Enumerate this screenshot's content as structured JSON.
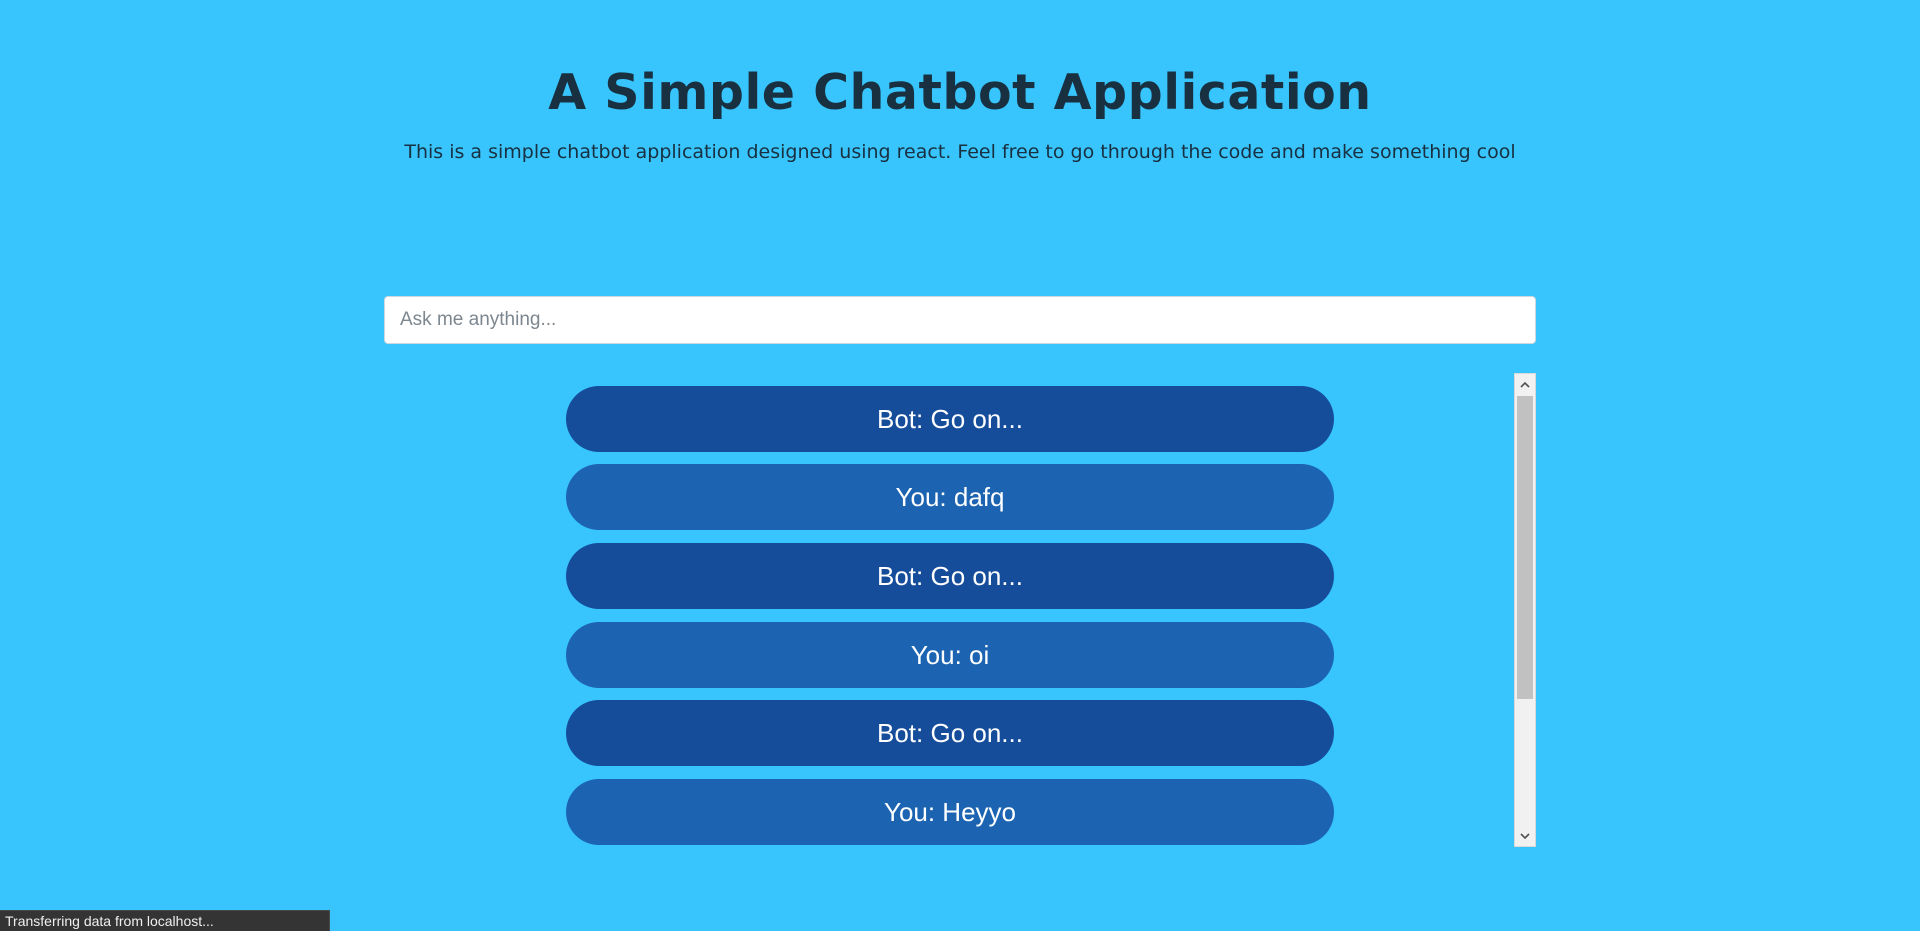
{
  "header": {
    "title": "A Simple Chatbot Application",
    "subtitle": "This is a simple chatbot application designed using react. Feel free to go through the code and make something cool"
  },
  "chat": {
    "input_value": "",
    "input_placeholder": "Ask me anything...",
    "messages": [
      {
        "sender": "bot",
        "text": "Bot: Go on..."
      },
      {
        "sender": "user",
        "text": "You: dafq"
      },
      {
        "sender": "bot",
        "text": "Bot: Go on..."
      },
      {
        "sender": "user",
        "text": "You: oi"
      },
      {
        "sender": "bot",
        "text": "Bot: Go on..."
      },
      {
        "sender": "user",
        "text": "You: Heyyo"
      }
    ]
  },
  "scrollbar": {
    "up_icon": "chevron-up-icon",
    "down_icon": "chevron-down-icon"
  },
  "status_bar": {
    "text": "Transferring data from localhost..."
  },
  "colors": {
    "background": "#38c4fd",
    "bot_bubble": "#154d9b",
    "user_bubble": "#1c64b1",
    "title_text": "#183040"
  }
}
